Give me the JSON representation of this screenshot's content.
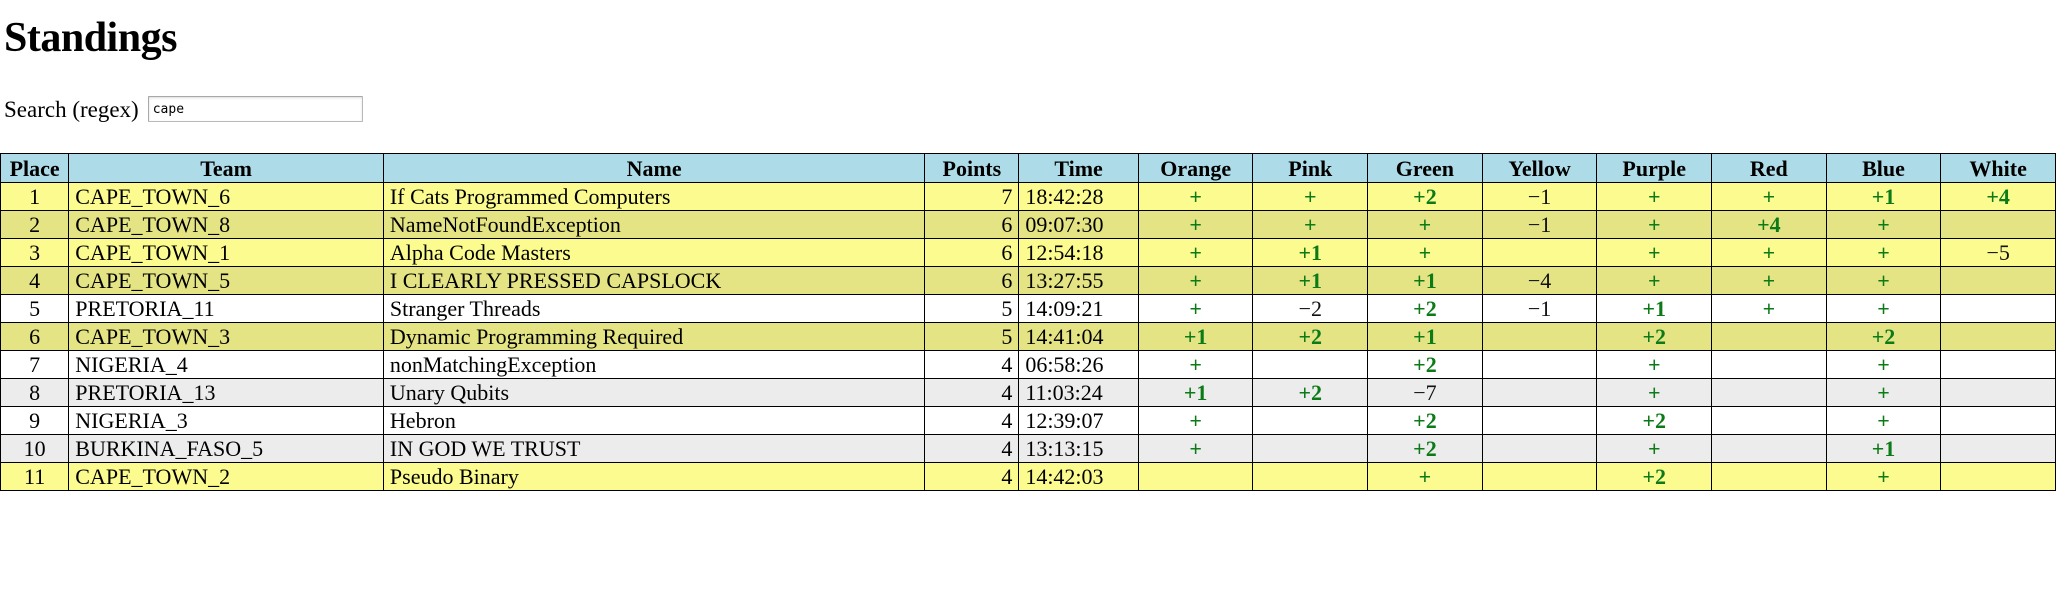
{
  "page": {
    "title": "Standings"
  },
  "search": {
    "label": "Search (regex)",
    "value": "cape",
    "placeholder": ""
  },
  "table": {
    "headers": [
      "Place",
      "Team",
      "Name",
      "Points",
      "Time",
      "Orange",
      "Pink",
      "Green",
      "Yellow",
      "Purple",
      "Red",
      "Blue",
      "White"
    ],
    "colors": {
      "header_bg": "#addce8",
      "match_row_a": "#fbfb8f",
      "match_row_b": "#e4e484",
      "row_a": "#ffffff",
      "row_b": "#ececec",
      "positive": "#0d7a18",
      "negative": "#111111"
    },
    "rows": [
      {
        "place": "1",
        "team": "CAPE_TOWN_6",
        "name": "If Cats Programmed Computers",
        "points": "7",
        "time": "18:42:28",
        "scores": [
          "+",
          "+",
          "+2",
          "−1",
          "+",
          "+",
          "+1",
          "+4"
        ],
        "style": "row-hl-a"
      },
      {
        "place": "2",
        "team": "CAPE_TOWN_8",
        "name": "NameNotFoundException",
        "points": "6",
        "time": "09:07:30",
        "scores": [
          "+",
          "+",
          "+",
          "−1",
          "+",
          "+4",
          "+",
          ""
        ],
        "style": "row-hl-b"
      },
      {
        "place": "3",
        "team": "CAPE_TOWN_1",
        "name": "Alpha Code Masters",
        "points": "6",
        "time": "12:54:18",
        "scores": [
          "+",
          "+1",
          "+",
          "",
          "+",
          "+",
          "+",
          "−5"
        ],
        "style": "row-hl-a"
      },
      {
        "place": "4",
        "team": "CAPE_TOWN_5",
        "name": "I CLEARLY PRESSED CAPSLOCK",
        "points": "6",
        "time": "13:27:55",
        "scores": [
          "+",
          "+1",
          "+1",
          "−4",
          "+",
          "+",
          "+",
          ""
        ],
        "style": "row-hl-b"
      },
      {
        "place": "5",
        "team": "PRETORIA_11",
        "name": "Stranger Threads",
        "points": "5",
        "time": "14:09:21",
        "scores": [
          "+",
          "−2",
          "+2",
          "−1",
          "+1",
          "+",
          "+",
          ""
        ],
        "style": "row-n-a"
      },
      {
        "place": "6",
        "team": "CAPE_TOWN_3",
        "name": "Dynamic Programming Required",
        "points": "5",
        "time": "14:41:04",
        "scores": [
          "+1",
          "+2",
          "+1",
          "",
          "+2",
          "",
          "+2",
          ""
        ],
        "style": "row-hl-b"
      },
      {
        "place": "7",
        "team": "NIGERIA_4",
        "name": "nonMatchingException",
        "points": "4",
        "time": "06:58:26",
        "scores": [
          "+",
          "",
          "+2",
          "",
          "+",
          "",
          "+",
          ""
        ],
        "style": "row-n-a"
      },
      {
        "place": "8",
        "team": "PRETORIA_13",
        "name": "Unary Qubits",
        "points": "4",
        "time": "11:03:24",
        "scores": [
          "+1",
          "+2",
          "−7",
          "",
          "+",
          "",
          "+",
          ""
        ],
        "style": "row-n-b"
      },
      {
        "place": "9",
        "team": "NIGERIA_3",
        "name": "Hebron",
        "points": "4",
        "time": "12:39:07",
        "scores": [
          "+",
          "",
          "+2",
          "",
          "+2",
          "",
          "+",
          ""
        ],
        "style": "row-n-a"
      },
      {
        "place": "10",
        "team": "BURKINA_FASO_5",
        "name": "IN GOD WE TRUST",
        "points": "4",
        "time": "13:13:15",
        "scores": [
          "+",
          "",
          "+2",
          "",
          "+",
          "",
          "+1",
          ""
        ],
        "style": "row-n-b"
      },
      {
        "place": "11",
        "team": "CAPE_TOWN_2",
        "name": "Pseudo Binary",
        "points": "4",
        "time": "14:42:03",
        "scores": [
          "",
          "",
          "+",
          "",
          "+2",
          "",
          "+",
          ""
        ],
        "style": "row-hl-a"
      }
    ]
  }
}
